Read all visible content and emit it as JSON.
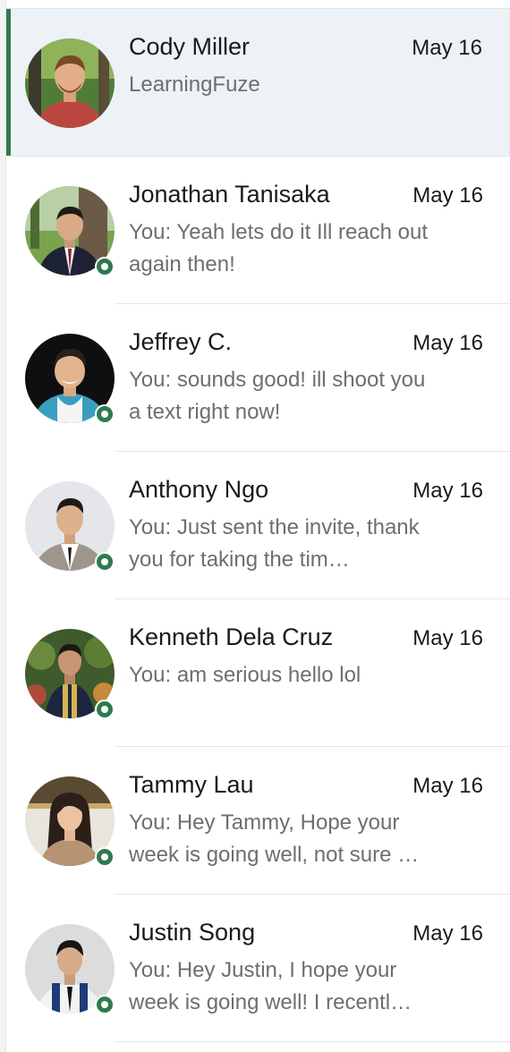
{
  "conversations": [
    {
      "name": "Cody Miller",
      "date": "May 16",
      "preview": "LearningFuze",
      "online": false,
      "active": true
    },
    {
      "name": "Jonathan Tanisaka",
      "date": "May 16",
      "preview": "You: Yeah lets do it Ill reach out again then!",
      "online": true,
      "active": false
    },
    {
      "name": "Jeffrey C.",
      "date": "May 16",
      "preview": "You: sounds good! ill shoot you a text right now!",
      "online": true,
      "active": false
    },
    {
      "name": "Anthony Ngo",
      "date": "May 16",
      "preview": "You: Just sent the invite, thank you for taking the tim…",
      "online": true,
      "active": false
    },
    {
      "name": "Kenneth Dela Cruz",
      "date": "May 16",
      "preview": "You: am serious hello  lol",
      "online": true,
      "active": false
    },
    {
      "name": "Tammy Lau",
      "date": "May 16",
      "preview": "You: Hey Tammy, Hope your week is going well, not sure …",
      "online": true,
      "active": false
    },
    {
      "name": "Justin Song",
      "date": "May 16",
      "preview": "You: Hey Justin, I hope your week is going well! I  recentl…",
      "online": true,
      "active": false
    }
  ],
  "colors": {
    "accent": "#2f7b4f",
    "presence": "#2e7a4f",
    "active_bg": "#edf2f7"
  },
  "icons": {
    "presence": "online-status-icon"
  }
}
